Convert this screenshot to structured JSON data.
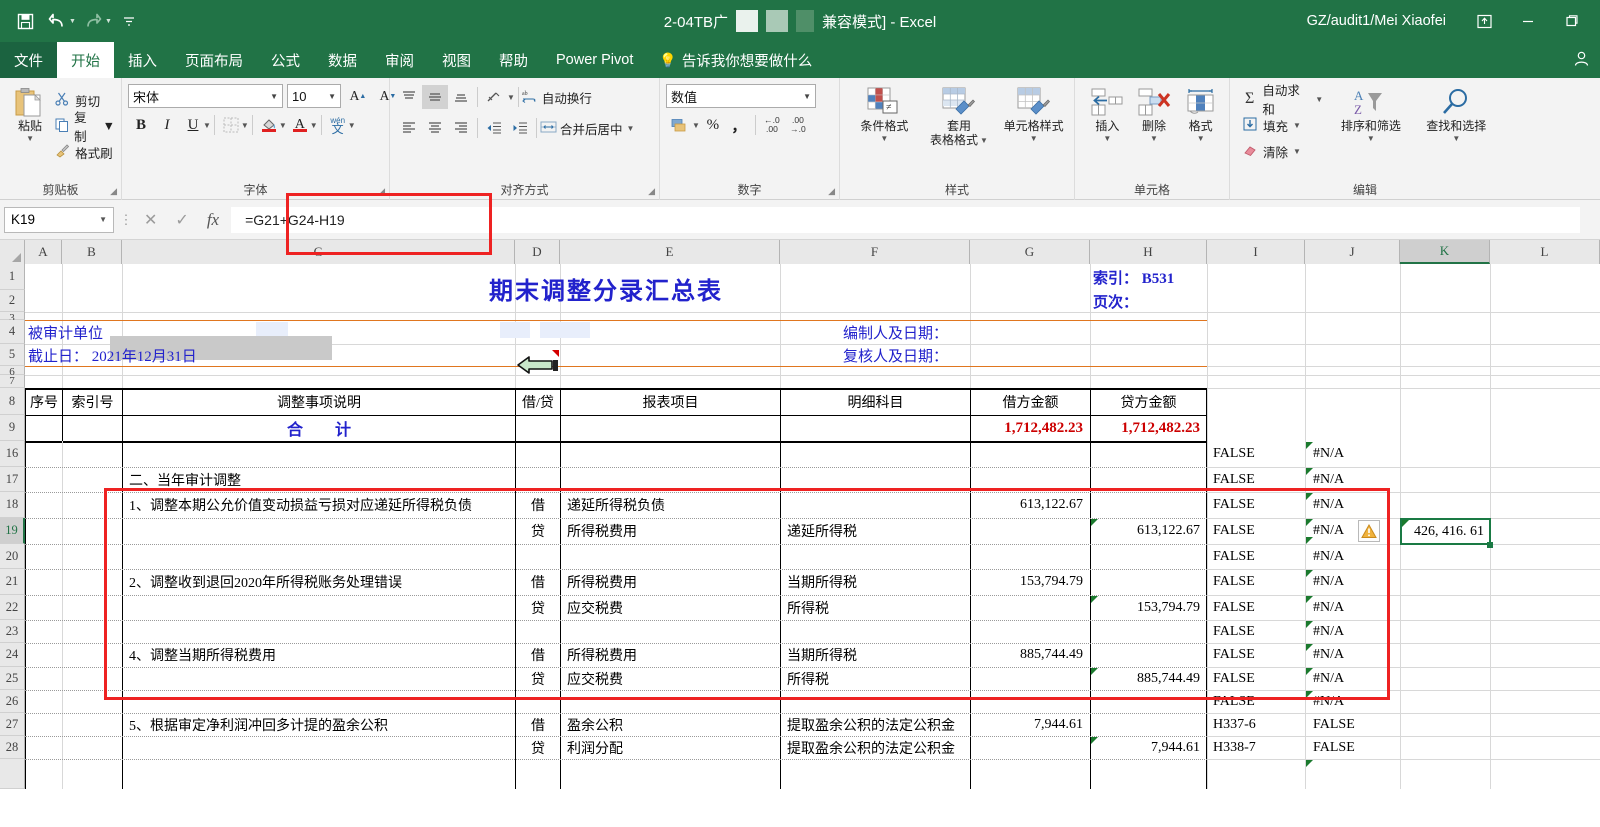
{
  "titlebar": {
    "qat": [
      {
        "name": "save-icon",
        "glyph": "ὋE"
      },
      {
        "name": "undo-icon",
        "glyph": "↶"
      },
      {
        "name": "redo-icon",
        "glyph": "↷"
      },
      {
        "name": "customize-qat-icon",
        "glyph": "▾"
      }
    ],
    "doc_name": "2-04TB广",
    "mode_suffix": "兼容模式] - Excel",
    "user": "GZ/audit1/Mei Xiaofei",
    "ribbon_display_icon": "⬚",
    "minimize": "─",
    "restore": "❐"
  },
  "tabs": [
    {
      "label": "文件",
      "kind": "file"
    },
    {
      "label": "开始",
      "kind": "active"
    },
    {
      "label": "插入",
      "kind": "normal"
    },
    {
      "label": "页面布局",
      "kind": "normal"
    },
    {
      "label": "公式",
      "kind": "normal"
    },
    {
      "label": "数据",
      "kind": "normal"
    },
    {
      "label": "审阅",
      "kind": "normal"
    },
    {
      "label": "视图",
      "kind": "normal"
    },
    {
      "label": "帮助",
      "kind": "normal"
    },
    {
      "label": "Power Pivot",
      "kind": "normal"
    }
  ],
  "tellme": "告诉我你想要做什么",
  "account_icon": "὆4",
  "ribbon": {
    "clipboard": {
      "group_label": "剪贴板",
      "paste": "粘贴",
      "cut": "剪切",
      "copy": "复制",
      "format_painter": "格式刷"
    },
    "font": {
      "group_label": "字体",
      "font_name": "宋体",
      "font_size": "10",
      "grow": "A",
      "shrink": "A",
      "bold": "B",
      "italic": "I",
      "underline": "U",
      "border": "⌸",
      "fill": "὘C",
      "font_color": "A",
      "phonetic": "文"
    },
    "alignment": {
      "group_label": "对齐方式",
      "wrap_text": "自动换行",
      "merge_center": "合并后居中",
      "orientation": "⟋"
    },
    "number": {
      "group_label": "数字",
      "format": "数值",
      "percent": "%",
      "comma": "，",
      "inc_dec": ".00",
      "dec_dec": ".00"
    },
    "styles": {
      "group_label": "样式",
      "conditional": "条件格式",
      "table_format_1": "套用",
      "table_format_2": "表格格式",
      "cell_styles": "单元格样式"
    },
    "cells": {
      "group_label": "单元格",
      "insert": "插入",
      "delete": "删除",
      "format": "格式"
    },
    "editing": {
      "group_label": "编辑",
      "autosum": "自动求和",
      "fill": "填充",
      "clear": "清除",
      "sort_filter": "排序和筛选",
      "find_select": "查找和选择"
    }
  },
  "formula_bar": {
    "name_box": "K19",
    "cancel_icon": "✕",
    "accept_icon": "✓",
    "fx_icon": "fx",
    "formula": "=G21+G24-H19"
  },
  "grid": {
    "columns": [
      "A",
      "B",
      "C",
      "D",
      "E",
      "F",
      "G",
      "H",
      "I",
      "J",
      "K",
      "L"
    ],
    "selected_column": "K",
    "rows": [
      "1",
      "2",
      "3",
      "4",
      "5",
      "6",
      "7",
      "8",
      "9",
      "16",
      "17",
      "18",
      "19",
      "20",
      "21",
      "22",
      "23",
      "24",
      "25",
      "26",
      "27",
      "28"
    ],
    "selected_row": "19",
    "selected_cell": "K19",
    "title": "期末调整分录汇总表",
    "index_label": "索引： B531",
    "page_label": "页次：",
    "audited_entity": "被审计单位",
    "cutoff_date": "截止日： 2021年12月31日",
    "preparer": "编制人及日期：",
    "reviewer": "复核人及日期：",
    "headers": {
      "seq": "序号",
      "index": "索引号",
      "description": "调整事项说明",
      "dr_cr": "借/贷",
      "statement_item": "报表项目",
      "detail_account": "明细科目",
      "debit": "借方金额",
      "credit": "贷方金额"
    },
    "total_label": "合　　计",
    "total_debit": "1,712,482.23",
    "total_credit": "1,712,482.23",
    "section_header": "二、当年审计调整",
    "data_rows": [
      {
        "row": "16",
        "desc": "",
        "drcr": "",
        "item": "",
        "detail": "",
        "debit": "",
        "credit": "",
        "i": "FALSE",
        "j": "#N/A"
      },
      {
        "row": "17",
        "desc": "二、当年审计调整",
        "drcr": "",
        "item": "",
        "detail": "",
        "debit": "",
        "credit": "",
        "i": "FALSE",
        "j": "#N/A"
      },
      {
        "row": "18",
        "desc": "1、调整本期公允价值变动损益亏损对应递延所得税负债",
        "drcr": "借",
        "item": "递延所得税负债",
        "detail": "",
        "debit": "613,122.67",
        "credit": "",
        "i": "FALSE",
        "j": "#N/A"
      },
      {
        "row": "19",
        "desc": "",
        "drcr": "贷",
        "item": "所得税费用",
        "detail": "递延所得税",
        "debit": "",
        "credit": "613,122.67",
        "i": "FALSE",
        "j": "#N/A"
      },
      {
        "row": "20",
        "desc": "",
        "drcr": "",
        "item": "",
        "detail": "",
        "debit": "",
        "credit": "",
        "i": "FALSE",
        "j": "#N/A"
      },
      {
        "row": "21",
        "desc": "2、调整收到退回2020年所得税账务处理错误",
        "drcr": "借",
        "item": "所得税费用",
        "detail": "当期所得税",
        "debit": "153,794.79",
        "credit": "",
        "i": "FALSE",
        "j": "#N/A"
      },
      {
        "row": "22",
        "desc": "",
        "drcr": "贷",
        "item": "应交税费",
        "detail": "所得税",
        "debit": "",
        "credit": "153,794.79",
        "i": "FALSE",
        "j": "#N/A"
      },
      {
        "row": "23",
        "desc": "",
        "drcr": "",
        "item": "",
        "detail": "",
        "debit": "",
        "credit": "",
        "i": "FALSE",
        "j": "#N/A"
      },
      {
        "row": "24",
        "desc": "4、调整当期所得税费用",
        "drcr": "借",
        "item": "所得税费用",
        "detail": "当期所得税",
        "debit": "885,744.49",
        "credit": "",
        "i": "FALSE",
        "j": "#N/A"
      },
      {
        "row": "25",
        "desc": "",
        "drcr": "贷",
        "item": "应交税费",
        "detail": "所得税",
        "debit": "",
        "credit": "885,744.49",
        "i": "FALSE",
        "j": "#N/A"
      },
      {
        "row": "26",
        "desc": "",
        "drcr": "",
        "item": "",
        "detail": "",
        "debit": "",
        "credit": "",
        "i": "FALSE",
        "j": "#N/A"
      },
      {
        "row": "27",
        "desc": "5、根据审定净利润冲回多计提的盈余公积",
        "drcr": "借",
        "item": "盈余公积",
        "detail": "提取盈余公积的法定公积金",
        "debit": "7,944.61",
        "credit": "",
        "i": "H337-6",
        "j": "FALSE"
      },
      {
        "row": "28",
        "desc": "",
        "drcr": "贷",
        "item": "利润分配",
        "detail": "提取盈余公积的法定公积金",
        "debit": "",
        "credit": "7,944.61",
        "i": "H338-7",
        "j": "FALSE"
      }
    ],
    "k19_value": "426, 416. 61",
    "warning_icon": "!"
  },
  "colors": {
    "excel_green": "#217346",
    "title_blue": "#2222cc",
    "total_red": "#cc0000",
    "annotation_red": "#ee2222",
    "selection_green": "#1a7a44",
    "orange_rule": "#e0761f"
  }
}
